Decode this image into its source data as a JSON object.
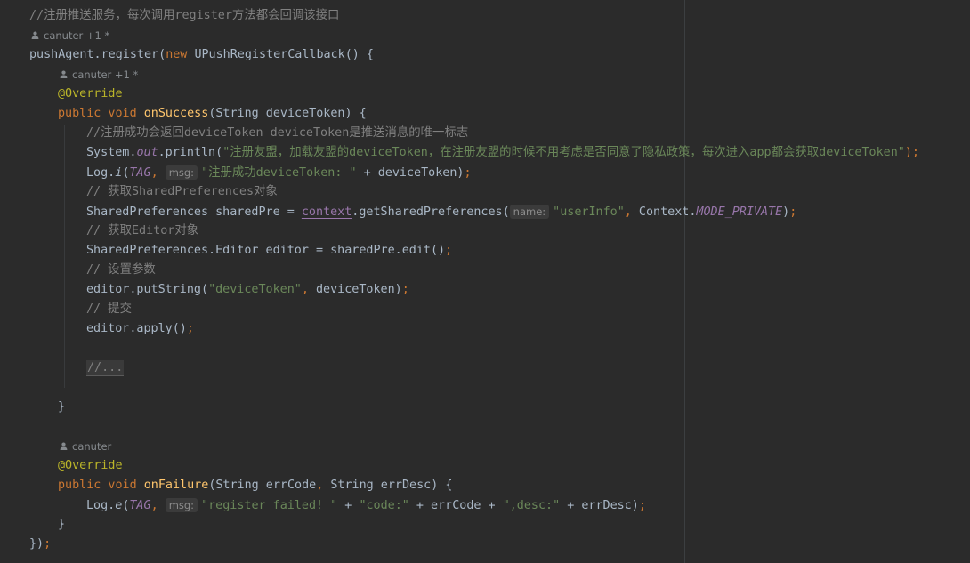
{
  "editor": {
    "lines": [
      {
        "kind": "code",
        "indent": 0,
        "spans": [
          {
            "t": "//注册推送服务，每次调用register方法都会回调该接口",
            "c": "comment"
          }
        ]
      },
      {
        "kind": "author",
        "indent": 0,
        "text": "canuter +1 *"
      },
      {
        "kind": "code",
        "indent": 0,
        "spans": [
          {
            "t": "pushAgent.register("
          },
          {
            "t": "new ",
            "c": "kw"
          },
          {
            "t": "UPushRegisterCallback() {"
          }
        ]
      },
      {
        "kind": "author",
        "indent": 1,
        "text": "canuter +1 *"
      },
      {
        "kind": "code",
        "indent": 1,
        "spans": [
          {
            "t": "@Override",
            "c": "anno"
          }
        ]
      },
      {
        "kind": "code",
        "indent": 1,
        "spans": [
          {
            "t": "public void ",
            "c": "kw"
          },
          {
            "t": "onSuccess",
            "c": "fn"
          },
          {
            "t": "(String deviceToken) {"
          }
        ]
      },
      {
        "kind": "code",
        "indent": 2,
        "spans": [
          {
            "t": "//注册成功会返回deviceToken deviceToken是推送消息的唯一标志",
            "c": "comment"
          }
        ]
      },
      {
        "kind": "code",
        "indent": 2,
        "spans": [
          {
            "t": "System."
          },
          {
            "t": "out",
            "c": "italic-static"
          },
          {
            "t": ".println("
          },
          {
            "t": "\"注册友盟，加载友盟的deviceToken，在注册友盟的时候不用考虑是否同意了隐私政策，每次进入app都会获取deviceToken\"",
            "c": "str"
          },
          {
            "t": ");",
            "c": "punct"
          }
        ]
      },
      {
        "kind": "code",
        "indent": 2,
        "spans": [
          {
            "t": "Log."
          },
          {
            "t": "i",
            "c": "italic-plain"
          },
          {
            "t": "("
          },
          {
            "t": "TAG",
            "c": "italic-static"
          },
          {
            "t": ", ",
            "c": "punct"
          },
          {
            "hint": "msg:"
          },
          {
            "t": "\"注册成功deviceToken: \"",
            "c": "str"
          },
          {
            "t": " + deviceToken)"
          },
          {
            "t": ";",
            "c": "punct"
          }
        ]
      },
      {
        "kind": "code",
        "indent": 2,
        "spans": [
          {
            "t": "// 获取SharedPreferences对象",
            "c": "comment"
          }
        ]
      },
      {
        "kind": "code",
        "indent": 2,
        "spans": [
          {
            "t": "SharedPreferences sharedPre = "
          },
          {
            "t": "context",
            "c": "field-ul"
          },
          {
            "t": ".getSharedPreferences("
          },
          {
            "hint": "name:"
          },
          {
            "t": "\"userInfo\"",
            "c": "str"
          },
          {
            "t": ", ",
            "c": "punct"
          },
          {
            "t": "Context."
          },
          {
            "t": "MODE_PRIVATE",
            "c": "italic-static"
          },
          {
            "t": ")"
          },
          {
            "t": ";",
            "c": "punct"
          }
        ]
      },
      {
        "kind": "code",
        "indent": 2,
        "spans": [
          {
            "t": "// 获取Editor对象",
            "c": "comment"
          }
        ]
      },
      {
        "kind": "code",
        "indent": 2,
        "spans": [
          {
            "t": "SharedPreferences.Editor editor = sharedPre.edit()"
          },
          {
            "t": ";",
            "c": "punct"
          }
        ]
      },
      {
        "kind": "code",
        "indent": 2,
        "spans": [
          {
            "t": "// 设置参数",
            "c": "comment"
          }
        ]
      },
      {
        "kind": "code",
        "indent": 2,
        "spans": [
          {
            "t": "editor.putString("
          },
          {
            "t": "\"deviceToken\"",
            "c": "str"
          },
          {
            "t": ", ",
            "c": "punct"
          },
          {
            "t": "deviceToken)"
          },
          {
            "t": ";",
            "c": "punct"
          }
        ]
      },
      {
        "kind": "code",
        "indent": 2,
        "spans": [
          {
            "t": "// 提交",
            "c": "comment"
          }
        ]
      },
      {
        "kind": "code",
        "indent": 2,
        "spans": [
          {
            "t": "editor.apply()"
          },
          {
            "t": ";",
            "c": "punct"
          }
        ]
      },
      {
        "kind": "blank"
      },
      {
        "kind": "code",
        "indent": 2,
        "spans": [
          {
            "fold": "//..."
          }
        ]
      },
      {
        "kind": "blank"
      },
      {
        "kind": "code",
        "indent": 1,
        "spans": [
          {
            "t": "}"
          }
        ]
      },
      {
        "kind": "blank"
      },
      {
        "kind": "author",
        "indent": 1,
        "text": "canuter"
      },
      {
        "kind": "code",
        "indent": 1,
        "spans": [
          {
            "t": "@Override",
            "c": "anno"
          }
        ]
      },
      {
        "kind": "code",
        "indent": 1,
        "spans": [
          {
            "t": "public void ",
            "c": "kw"
          },
          {
            "t": "onFailure",
            "c": "fn"
          },
          {
            "t": "(String errCode"
          },
          {
            "t": ", ",
            "c": "punct"
          },
          {
            "t": "String errDesc) {"
          }
        ]
      },
      {
        "kind": "code",
        "indent": 2,
        "spans": [
          {
            "t": "Log."
          },
          {
            "t": "e",
            "c": "italic-plain"
          },
          {
            "t": "("
          },
          {
            "t": "TAG",
            "c": "italic-static"
          },
          {
            "t": ", ",
            "c": "punct"
          },
          {
            "hint": "msg:"
          },
          {
            "t": "\"register failed! \"",
            "c": "str"
          },
          {
            "t": " + "
          },
          {
            "t": "\"code:\"",
            "c": "str"
          },
          {
            "t": " + errCode + "
          },
          {
            "t": "\",desc:\"",
            "c": "str"
          },
          {
            "t": " + errDesc)"
          },
          {
            "t": ";",
            "c": "punct"
          }
        ]
      },
      {
        "kind": "code",
        "indent": 1,
        "spans": [
          {
            "t": "}"
          }
        ]
      },
      {
        "kind": "code",
        "indent": 0,
        "spans": [
          {
            "t": "})"
          },
          {
            "t": ";",
            "c": "punct"
          }
        ]
      }
    ]
  }
}
